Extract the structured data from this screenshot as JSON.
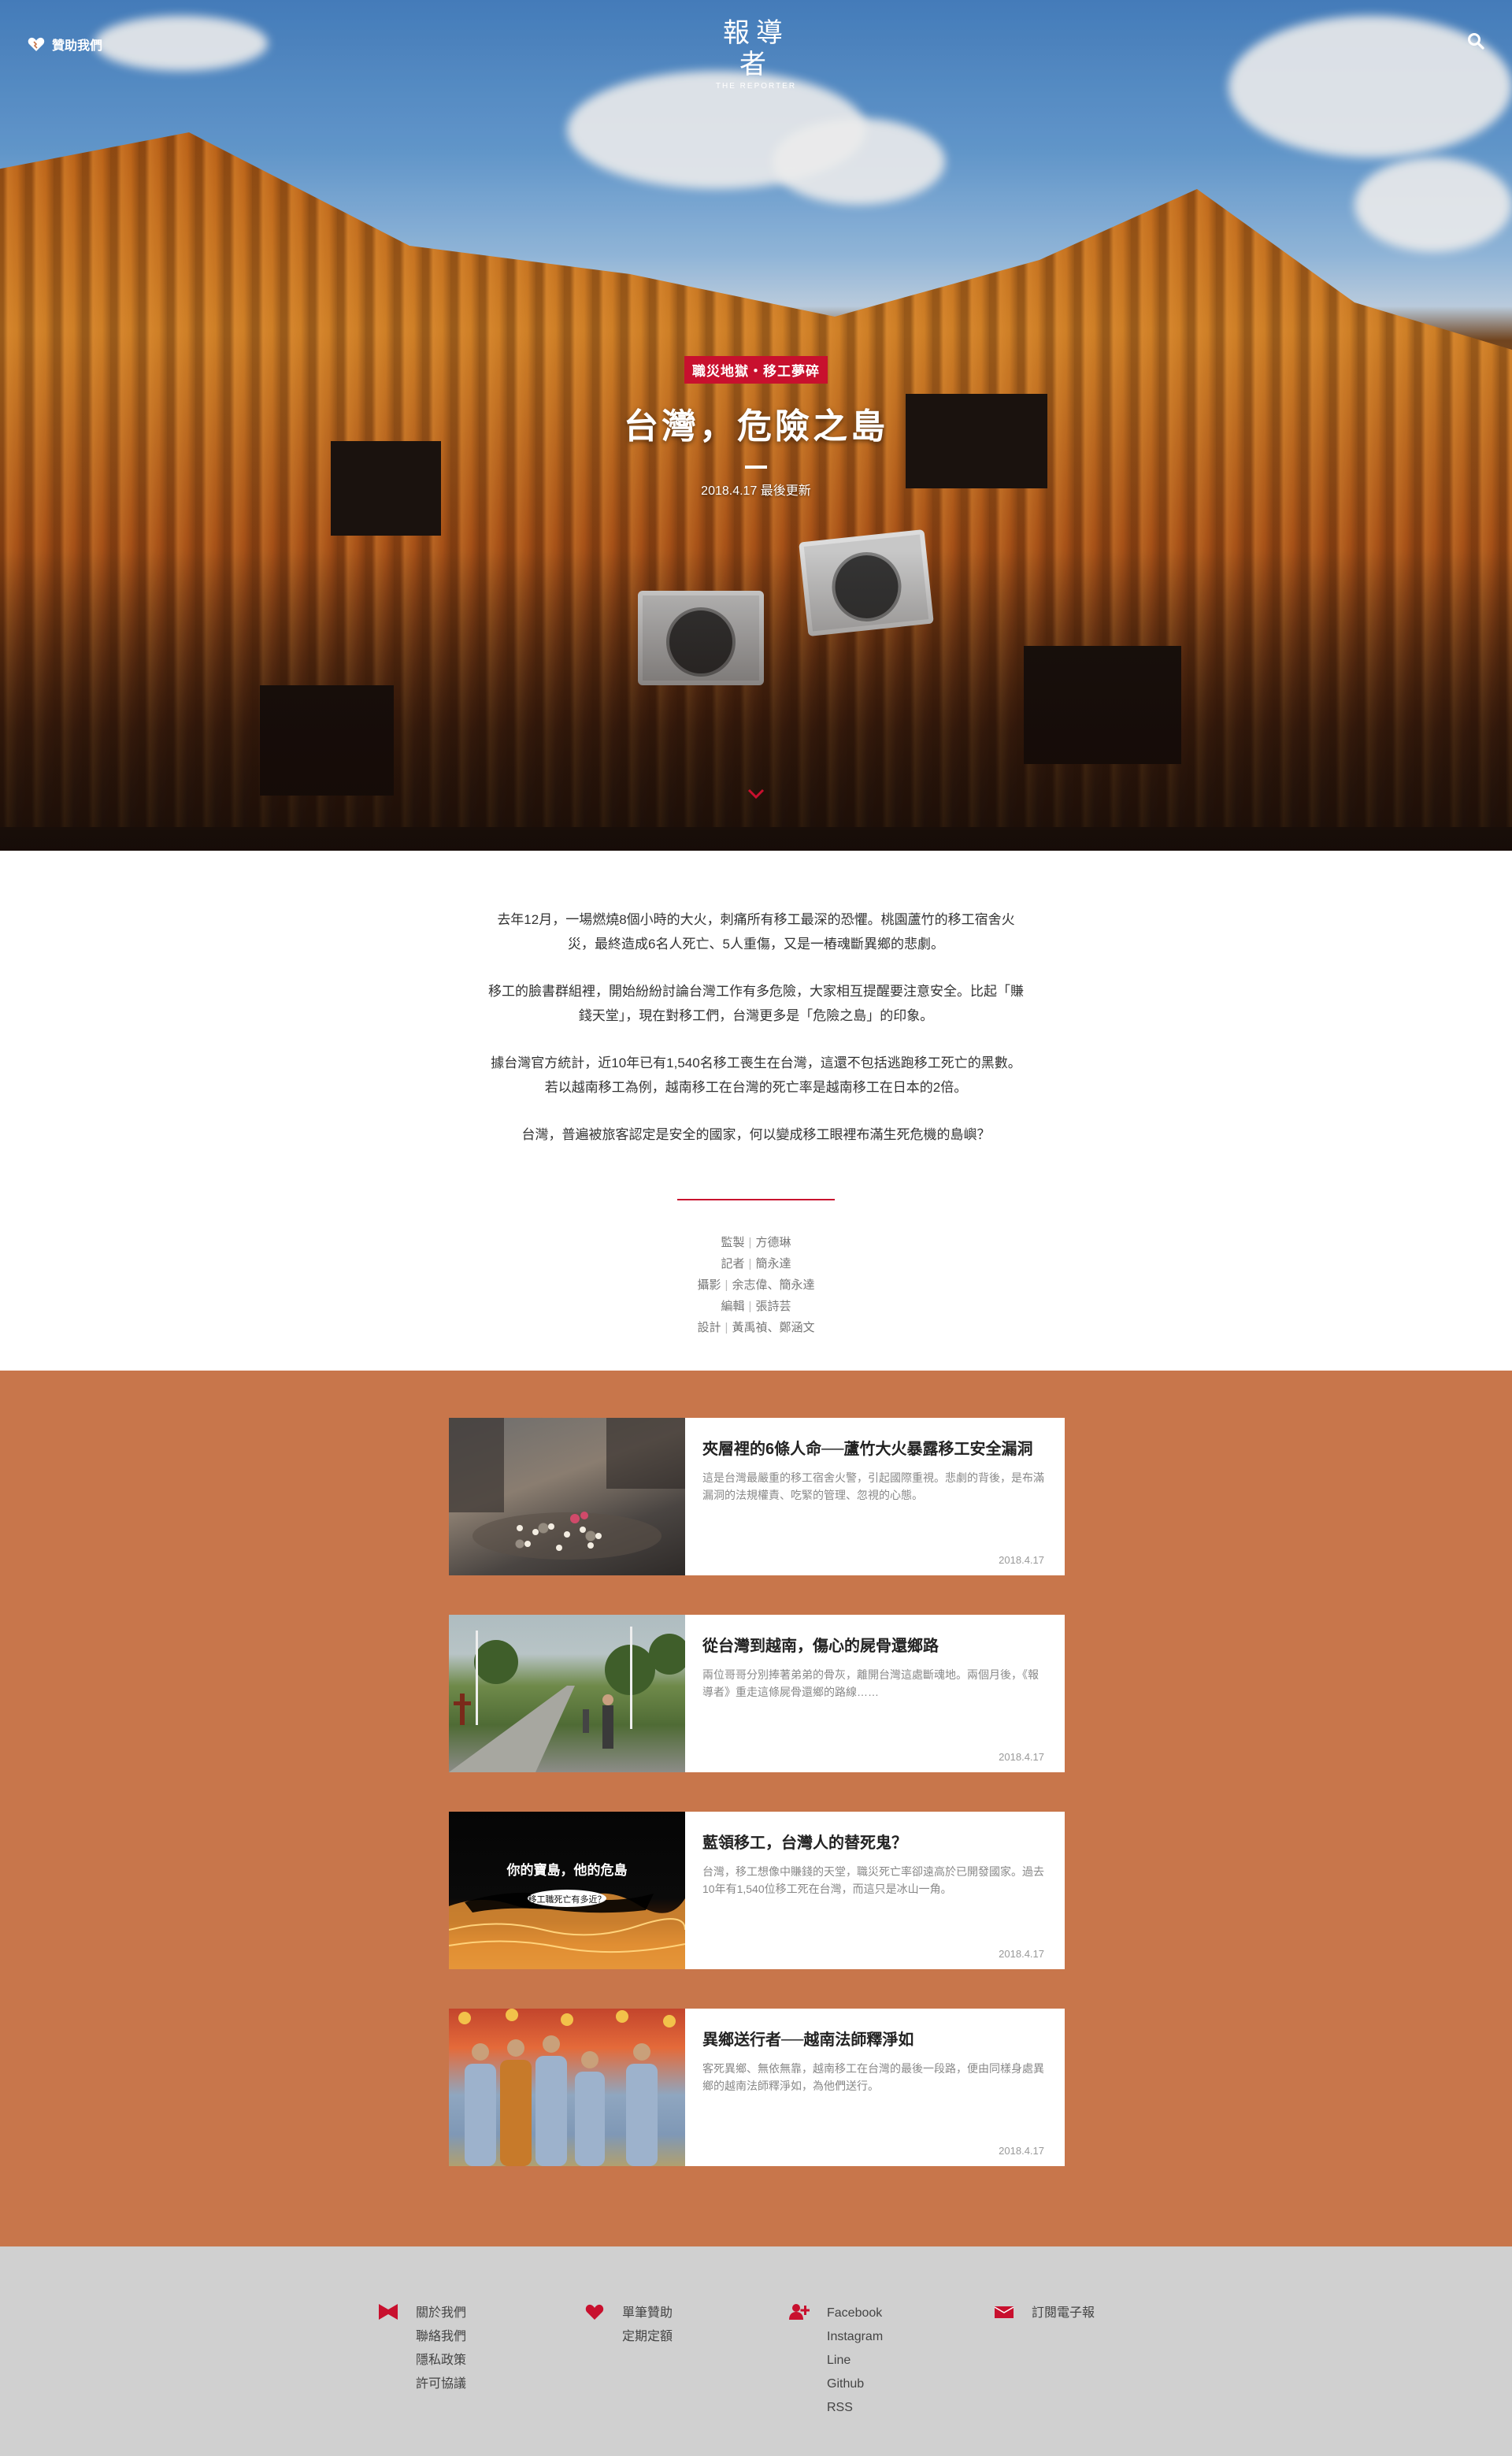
{
  "header": {
    "donate_label": "贊助我們",
    "logo_cn": "報導者",
    "logo_en": "THE REPORTER"
  },
  "hero": {
    "tag": "職災地獄・移工夢碎",
    "title": "台灣，危險之島",
    "date": "2018.4.17 最後更新"
  },
  "intro": {
    "paragraphs": [
      "去年12月，一場燃燒8個小時的大火，刺痛所有移工最深的恐懼。桃園蘆竹的移工宿舍火災，最終造成6名人死亡、5人重傷，又是一樁魂斷異鄉的悲劇。",
      "移工的臉書群組裡，開始紛紛討論台灣工作有多危險，大家相互提醒要注意安全。比起「賺錢天堂」，現在對移工們，台灣更多是「危險之島」的印象。",
      "據台灣官方統計，近10年已有1,540名移工喪生在台灣，這還不包括逃跑移工死亡的黑數。若以越南移工為例，越南移工在台灣的死亡率是越南移工在日本的2倍。",
      "台灣，普遍被旅客認定是安全的國家，何以變成移工眼裡布滿生死危機的島嶼？"
    ],
    "credits": [
      {
        "role": "監製",
        "names": "方德琳"
      },
      {
        "role": "記者",
        "names": "簡永達"
      },
      {
        "role": "攝影",
        "names": "余志偉、簡永達"
      },
      {
        "role": "編輯",
        "names": "張詩芸"
      },
      {
        "role": "設計",
        "names": "黃禹禎、鄭涵文"
      }
    ]
  },
  "stories": [
    {
      "title": "夾層裡的6條人命──蘆竹大火暴露移工安全漏洞",
      "desc": "這是台灣最嚴重的移工宿舍火警，引起國際重視。悲劇的背後，是布滿漏洞的法規權責、吃緊的管理、忽視的心態。",
      "date": "2018.4.17"
    },
    {
      "title": "從台灣到越南，傷心的屍骨還鄉路",
      "desc": "兩位哥哥分別捧著弟弟的骨灰，離開台灣這處斷魂地。兩個月後，《報導者》重走這條屍骨還鄉的路線……",
      "date": "2018.4.17"
    },
    {
      "title": "藍領移工，台灣人的替死鬼？",
      "desc": "台灣，移工想像中賺錢的天堂，職災死亡率卻遠高於已開發國家。過去10年有1,540位移工死在台灣，而這只是冰山一角。",
      "date": "2018.4.17",
      "image_text": "你的寶島，他的危島",
      "image_subtext": "移工職死亡有多近？"
    },
    {
      "title": "異鄉送行者──越南法師釋淨如",
      "desc": "客死異鄉、無依無靠，越南移工在台灣的最後一段路，便由同樣身處異鄉的越南法師釋淨如，為他們送行。",
      "date": "2018.4.17"
    }
  ],
  "footer": {
    "col1": [
      "關於我們",
      "聯絡我們",
      "隱私政策",
      "許可協議"
    ],
    "col2": [
      "單筆贊助",
      "定期定額"
    ],
    "col3": [
      "Facebook",
      "Instagram",
      "Line",
      "Github",
      "RSS"
    ],
    "col4": [
      "訂閱電子報"
    ]
  },
  "colors": {
    "accent": "#c8102e",
    "stories_bg": "#c8764b",
    "footer_bg": "#d0d0d0"
  }
}
